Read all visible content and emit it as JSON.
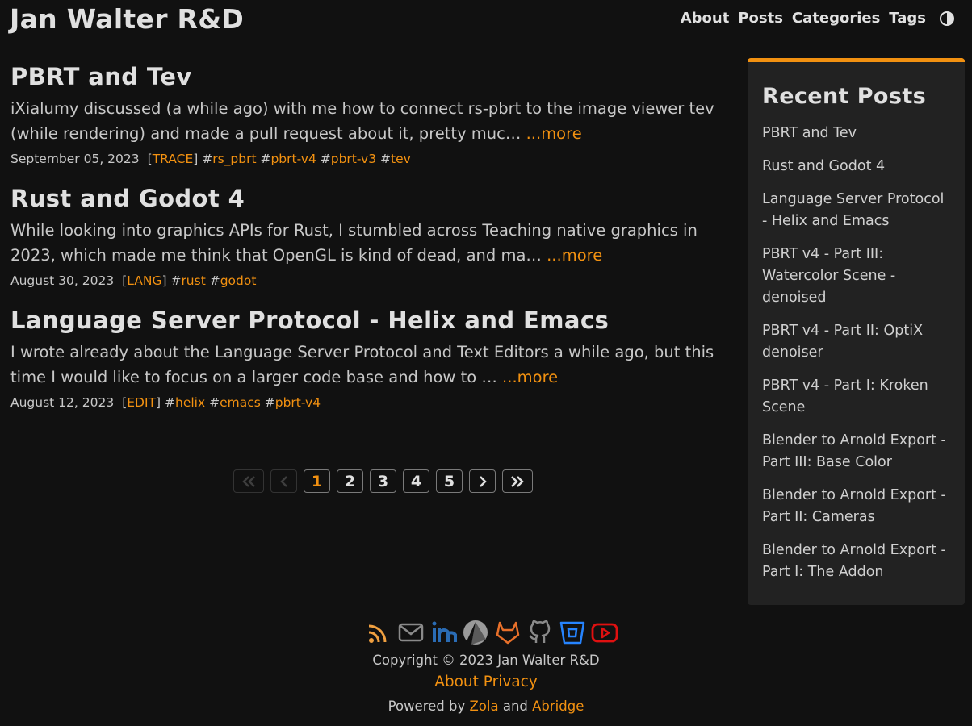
{
  "site": {
    "title": "Jan Walter R&D"
  },
  "nav": {
    "items": [
      "About",
      "Posts",
      "Categories",
      "Tags"
    ],
    "theme_toggle_icon": "contrast-icon"
  },
  "posts": [
    {
      "title": "PBRT and Tev",
      "summary": "iXialumy discussed (a while ago) with me how to connect rs-pbrt to the image viewer tev (while rendering) and made a pull request about it, pretty muc…",
      "more": "...more",
      "date": "September 05, 2023",
      "category": "TRACE",
      "tags": [
        "rs_pbrt",
        "pbrt-v4",
        "pbrt-v3",
        "tev"
      ]
    },
    {
      "title": "Rust and Godot 4",
      "summary": "While looking into graphics APIs for Rust, I stumbled across Teaching native graphics in 2023, which made me think that OpenGL is kind of dead, and ma…",
      "more": "...more",
      "date": "August 30, 2023",
      "category": "LANG",
      "tags": [
        "rust",
        "godot"
      ]
    },
    {
      "title": "Language Server Protocol - Helix and Emacs",
      "summary": "I wrote already about the Language Server Protocol and Text Editors a while ago, but this time I would like to focus on a larger code base and how to …",
      "more": "...more",
      "date": "August 12, 2023",
      "category": "EDIT",
      "tags": [
        "helix",
        "emacs",
        "pbrt-v4"
      ]
    }
  ],
  "pagination": {
    "first_icon": "double-chevron-left-icon",
    "prev_icon": "chevron-left-icon",
    "pages": [
      "1",
      "2",
      "3",
      "4",
      "5"
    ],
    "current": "1",
    "next_icon": "chevron-right-icon",
    "last_icon": "double-chevron-right-icon"
  },
  "sidebar": {
    "heading": "Recent Posts",
    "items": [
      "PBRT and Tev",
      "Rust and Godot 4",
      "Language Server Protocol - Helix and Emacs",
      "PBRT v4 - Part III: Watercolor Scene - denoised",
      "PBRT v4 - Part II: OptiX denoiser",
      "PBRT v4 - Part I: Kroken Scene",
      "Blender to Arnold Export - Part III: Base Color",
      "Blender to Arnold Export - Part II: Cameras",
      "Blender to Arnold Export - Part I: The Addon"
    ]
  },
  "footer": {
    "socials": [
      "rss-icon",
      "email-icon",
      "linkedin-icon",
      "mastodon-icon",
      "gitlab-icon",
      "github-icon",
      "bitbucket-icon",
      "youtube-icon"
    ],
    "copyright": "Copyright © 2023 Jan Walter R&D",
    "links": [
      "About",
      "Privacy"
    ],
    "powered_prefix": "Powered by",
    "powered_and": "and",
    "powered_links": [
      "Zola",
      "Abridge"
    ]
  },
  "colors": {
    "accent": "#f29111",
    "background": "#111111",
    "sidebar": "#222222",
    "text": "#dcdcdc"
  }
}
